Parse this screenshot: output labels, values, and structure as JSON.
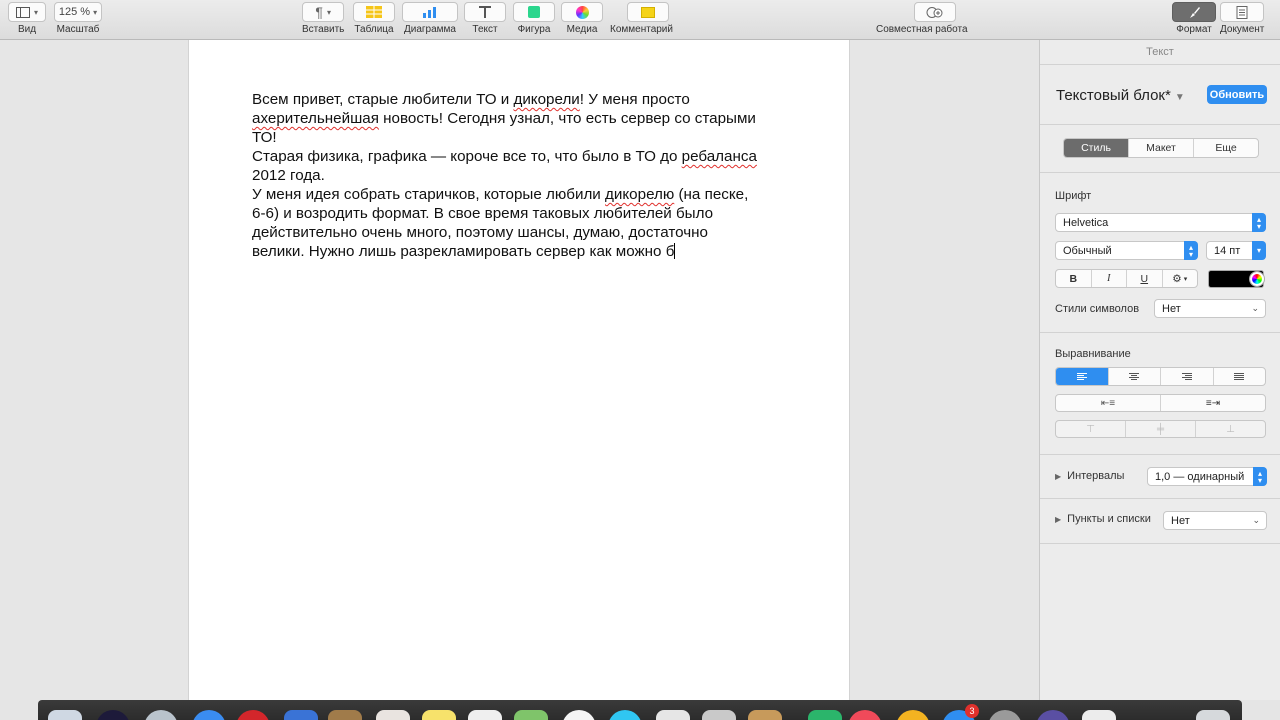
{
  "toolbar": {
    "view": {
      "label": "Вид",
      "icon": "sidebar-icon"
    },
    "zoom": {
      "label": "Масштаб",
      "value": "125 %"
    },
    "insert": {
      "label": "Вставить",
      "icon": "paragraph-icon"
    },
    "table": {
      "label": "Таблица",
      "icon": "table-icon"
    },
    "chart": {
      "label": "Диаграмма",
      "icon": "chart-icon"
    },
    "text": {
      "label": "Текст",
      "icon": "text-box-icon"
    },
    "shape": {
      "label": "Фигура",
      "icon": "shape-icon"
    },
    "media": {
      "label": "Медиа",
      "icon": "photos-icon"
    },
    "comment": {
      "label": "Комментарий",
      "icon": "comment-icon"
    },
    "collab": {
      "label": "Совместная работа",
      "icon": "collaborate-icon"
    },
    "format": {
      "label": "Формат",
      "icon": "paintbrush-icon"
    },
    "document": {
      "label": "Документ",
      "icon": "document-icon"
    }
  },
  "document": {
    "lines": [
      [
        {
          "t": "Всем привет, старые любители ТО и "
        },
        {
          "t": "дикорели",
          "sq": true
        },
        {
          "t": "! У меня просто"
        }
      ],
      [
        {
          "t": "ахерительнейшая",
          "sq": true
        },
        {
          "t": " новость! Сегодня узнал, что есть сервер со старыми"
        }
      ],
      [
        {
          "t": "ТО!"
        }
      ],
      [
        {
          "t": "Старая физика, графика — короче все то, что было в ТО до "
        },
        {
          "t": "ребаланса",
          "sq": true
        }
      ],
      [
        {
          "t": "2012 года."
        }
      ],
      [
        {
          "t": "У меня идея собрать старичков, которые любили "
        },
        {
          "t": "дикорелю",
          "sq": true
        },
        {
          "t": " (на песке,"
        }
      ],
      [
        {
          "t": "6-6) и возродить формат. В свое время таковых любителей было"
        }
      ],
      [
        {
          "t": "действительно очень много, поэтому шансы, думаю, достаточно"
        }
      ],
      [
        {
          "t": "велики. Нужно лишь разрекламировать сервер как можно б"
        }
      ]
    ]
  },
  "inspector": {
    "title": "Текст",
    "style_name": "Текстовый блок*",
    "update_label": "Обновить",
    "tabs": [
      "Стиль",
      "Макет",
      "Еще"
    ],
    "font_label": "Шрифт",
    "font_family": "Helvetica",
    "font_style": "Обычный",
    "font_size": "14 пт",
    "bold": "B",
    "italic": "I",
    "underline": "U",
    "gear": "⚙",
    "char_styles_label": "Стили символов",
    "char_styles_value": "Нет",
    "align_label": "Выравнивание",
    "spacing_label": "Интервалы",
    "spacing_value": "1,0 — одинарный",
    "bullets_label": "Пункты и списки",
    "bullets_value": "Нет",
    "text_color": "#000000"
  },
  "dock": {
    "badge": "3"
  }
}
